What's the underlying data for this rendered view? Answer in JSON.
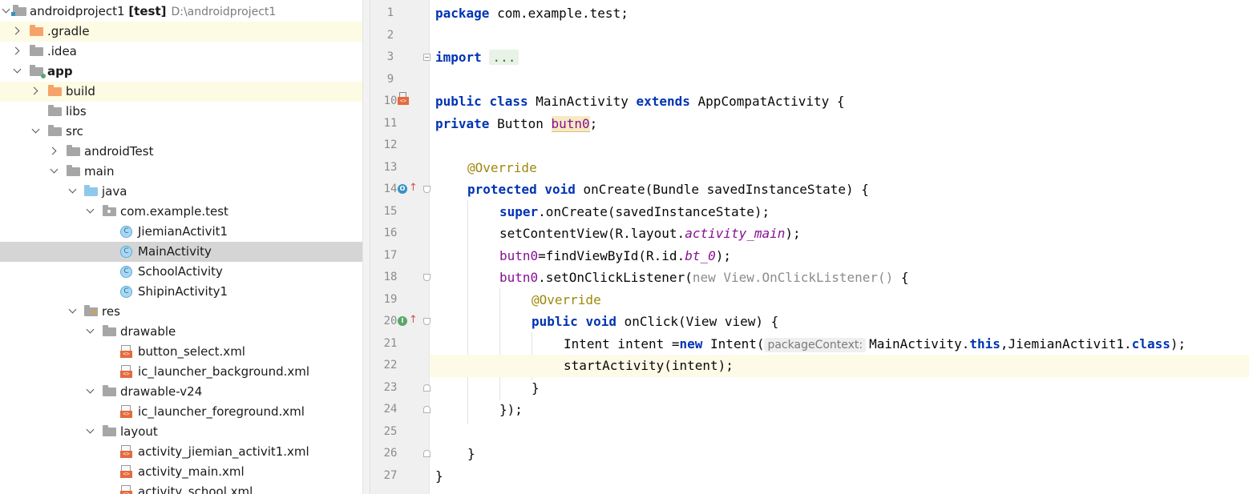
{
  "project_tree": {
    "root": {
      "name": "androidproject1",
      "module": "[test]",
      "path": "D:\\androidproject1"
    },
    "items": [
      {
        "label": ".gradle"
      },
      {
        "label": ".idea"
      },
      {
        "label": "app"
      },
      {
        "label": "build"
      },
      {
        "label": "libs"
      },
      {
        "label": "src"
      },
      {
        "label": "androidTest"
      },
      {
        "label": "main"
      },
      {
        "label": "java"
      },
      {
        "label": "com.example.test"
      },
      {
        "label": "JiemianActivit1"
      },
      {
        "label": "MainActivity"
      },
      {
        "label": "SchoolActivity"
      },
      {
        "label": "ShipinActivity1"
      },
      {
        "label": "res"
      },
      {
        "label": "drawable"
      },
      {
        "label": "button_select.xml"
      },
      {
        "label": "ic_launcher_background.xml"
      },
      {
        "label": "drawable-v24"
      },
      {
        "label": "ic_launcher_foreground.xml"
      },
      {
        "label": "layout"
      },
      {
        "label": "activity_jiemian_activit1.xml"
      },
      {
        "label": "activity_main.xml"
      },
      {
        "label": "activity_school.xml"
      }
    ],
    "class_icon_letter": "C"
  },
  "editor": {
    "line_numbers": [
      "1",
      "2",
      "3",
      "9",
      "10",
      "11",
      "12",
      "13",
      "14",
      "15",
      "16",
      "17",
      "18",
      "19",
      "20",
      "21",
      "22",
      "23",
      "24",
      "25",
      "26",
      "27"
    ],
    "gutter_badges": {
      "override": "O",
      "implements": "I",
      "up_arrow": "↑"
    },
    "tokens": {
      "l1_kw": "package",
      "l1_rest": " com.example.test;",
      "l3_kw": "import",
      "l3_folded": "...",
      "l10_kw1": "public",
      "l10_kw2": "class",
      "l10_name": " MainActivity ",
      "l10_kw3": "extends",
      "l10_rest": " AppCompatActivity {",
      "l11_kw": "private",
      "l11_type": " Button ",
      "l11_field": "butn0",
      "l11_end": ";",
      "l13_ann": "@Override",
      "l14_kw1": "protected",
      "l14_kw2": "void",
      "l14_rest": " onCreate(Bundle savedInstanceState) {",
      "l15_kw": "super",
      "l15_rest": ".onCreate(savedInstanceState);",
      "l16_a": "setContentView(R.layout.",
      "l16_b": "activity_main",
      "l16_c": ");",
      "l17_f": "butn0",
      "l17_a": "=findViewById(R.id.",
      "l17_b": "bt_0",
      "l17_c": ");",
      "l18_f": "butn0",
      "l18_a": ".setOnClickListener(",
      "l18_g1": "new",
      "l18_g2": " View.OnClickListener()",
      "l18_b": " {",
      "l19_ann": "@Override",
      "l20_kw1": "public",
      "l20_kw2": "void",
      "l20_rest": " onClick(View view) {",
      "l21_a": "Intent intent =",
      "l21_kw": "new",
      "l21_b": " Intent(",
      "l21_hint": "packageContext:",
      "l21_c": "MainActivity.",
      "l21_kw2": "this",
      "l21_d": ",JiemianActivit1.",
      "l21_kw3": "class",
      "l21_e": ");",
      "l22": "startActivity(intent);",
      "l23": "}",
      "l24": "});",
      "l26": "}",
      "l27": "}"
    }
  },
  "colors": {
    "keyword": "#0033b3",
    "annotation": "#9e880d",
    "field": "#871094",
    "current_line": "#fefae8",
    "selected_row": "#d5d5d5"
  }
}
